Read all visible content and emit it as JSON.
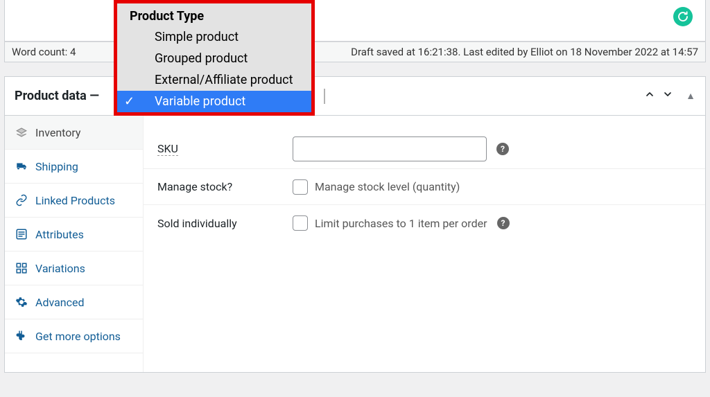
{
  "status_bar": {
    "word_count": "Word count: 4",
    "draft_info": "Draft saved at 16:21:38. Last edited by Elliot on 18 November 2022 at 14:57"
  },
  "product_data": {
    "title": "Product data —"
  },
  "dropdown": {
    "header": "Product Type",
    "items": {
      "0": "Simple product",
      "1": "Grouped product",
      "2": "External/Affiliate product",
      "3": "Variable product"
    },
    "selected_index": 3
  },
  "tabs": {
    "0": {
      "label": "Inventory"
    },
    "1": {
      "label": "Shipping"
    },
    "2": {
      "label": "Linked Products"
    },
    "3": {
      "label": "Attributes"
    },
    "4": {
      "label": "Variations"
    },
    "5": {
      "label": "Advanced"
    },
    "6": {
      "label": "Get more options"
    }
  },
  "panel": {
    "sku_label": "SKU",
    "sku_value": "",
    "manage_stock_label": "Manage stock?",
    "manage_stock_check_label": "Manage stock level (quantity)",
    "sold_individually_label": "Sold individually",
    "sold_individually_check_label": "Limit purchases to 1 item per order"
  },
  "icons": {
    "help": "?"
  }
}
